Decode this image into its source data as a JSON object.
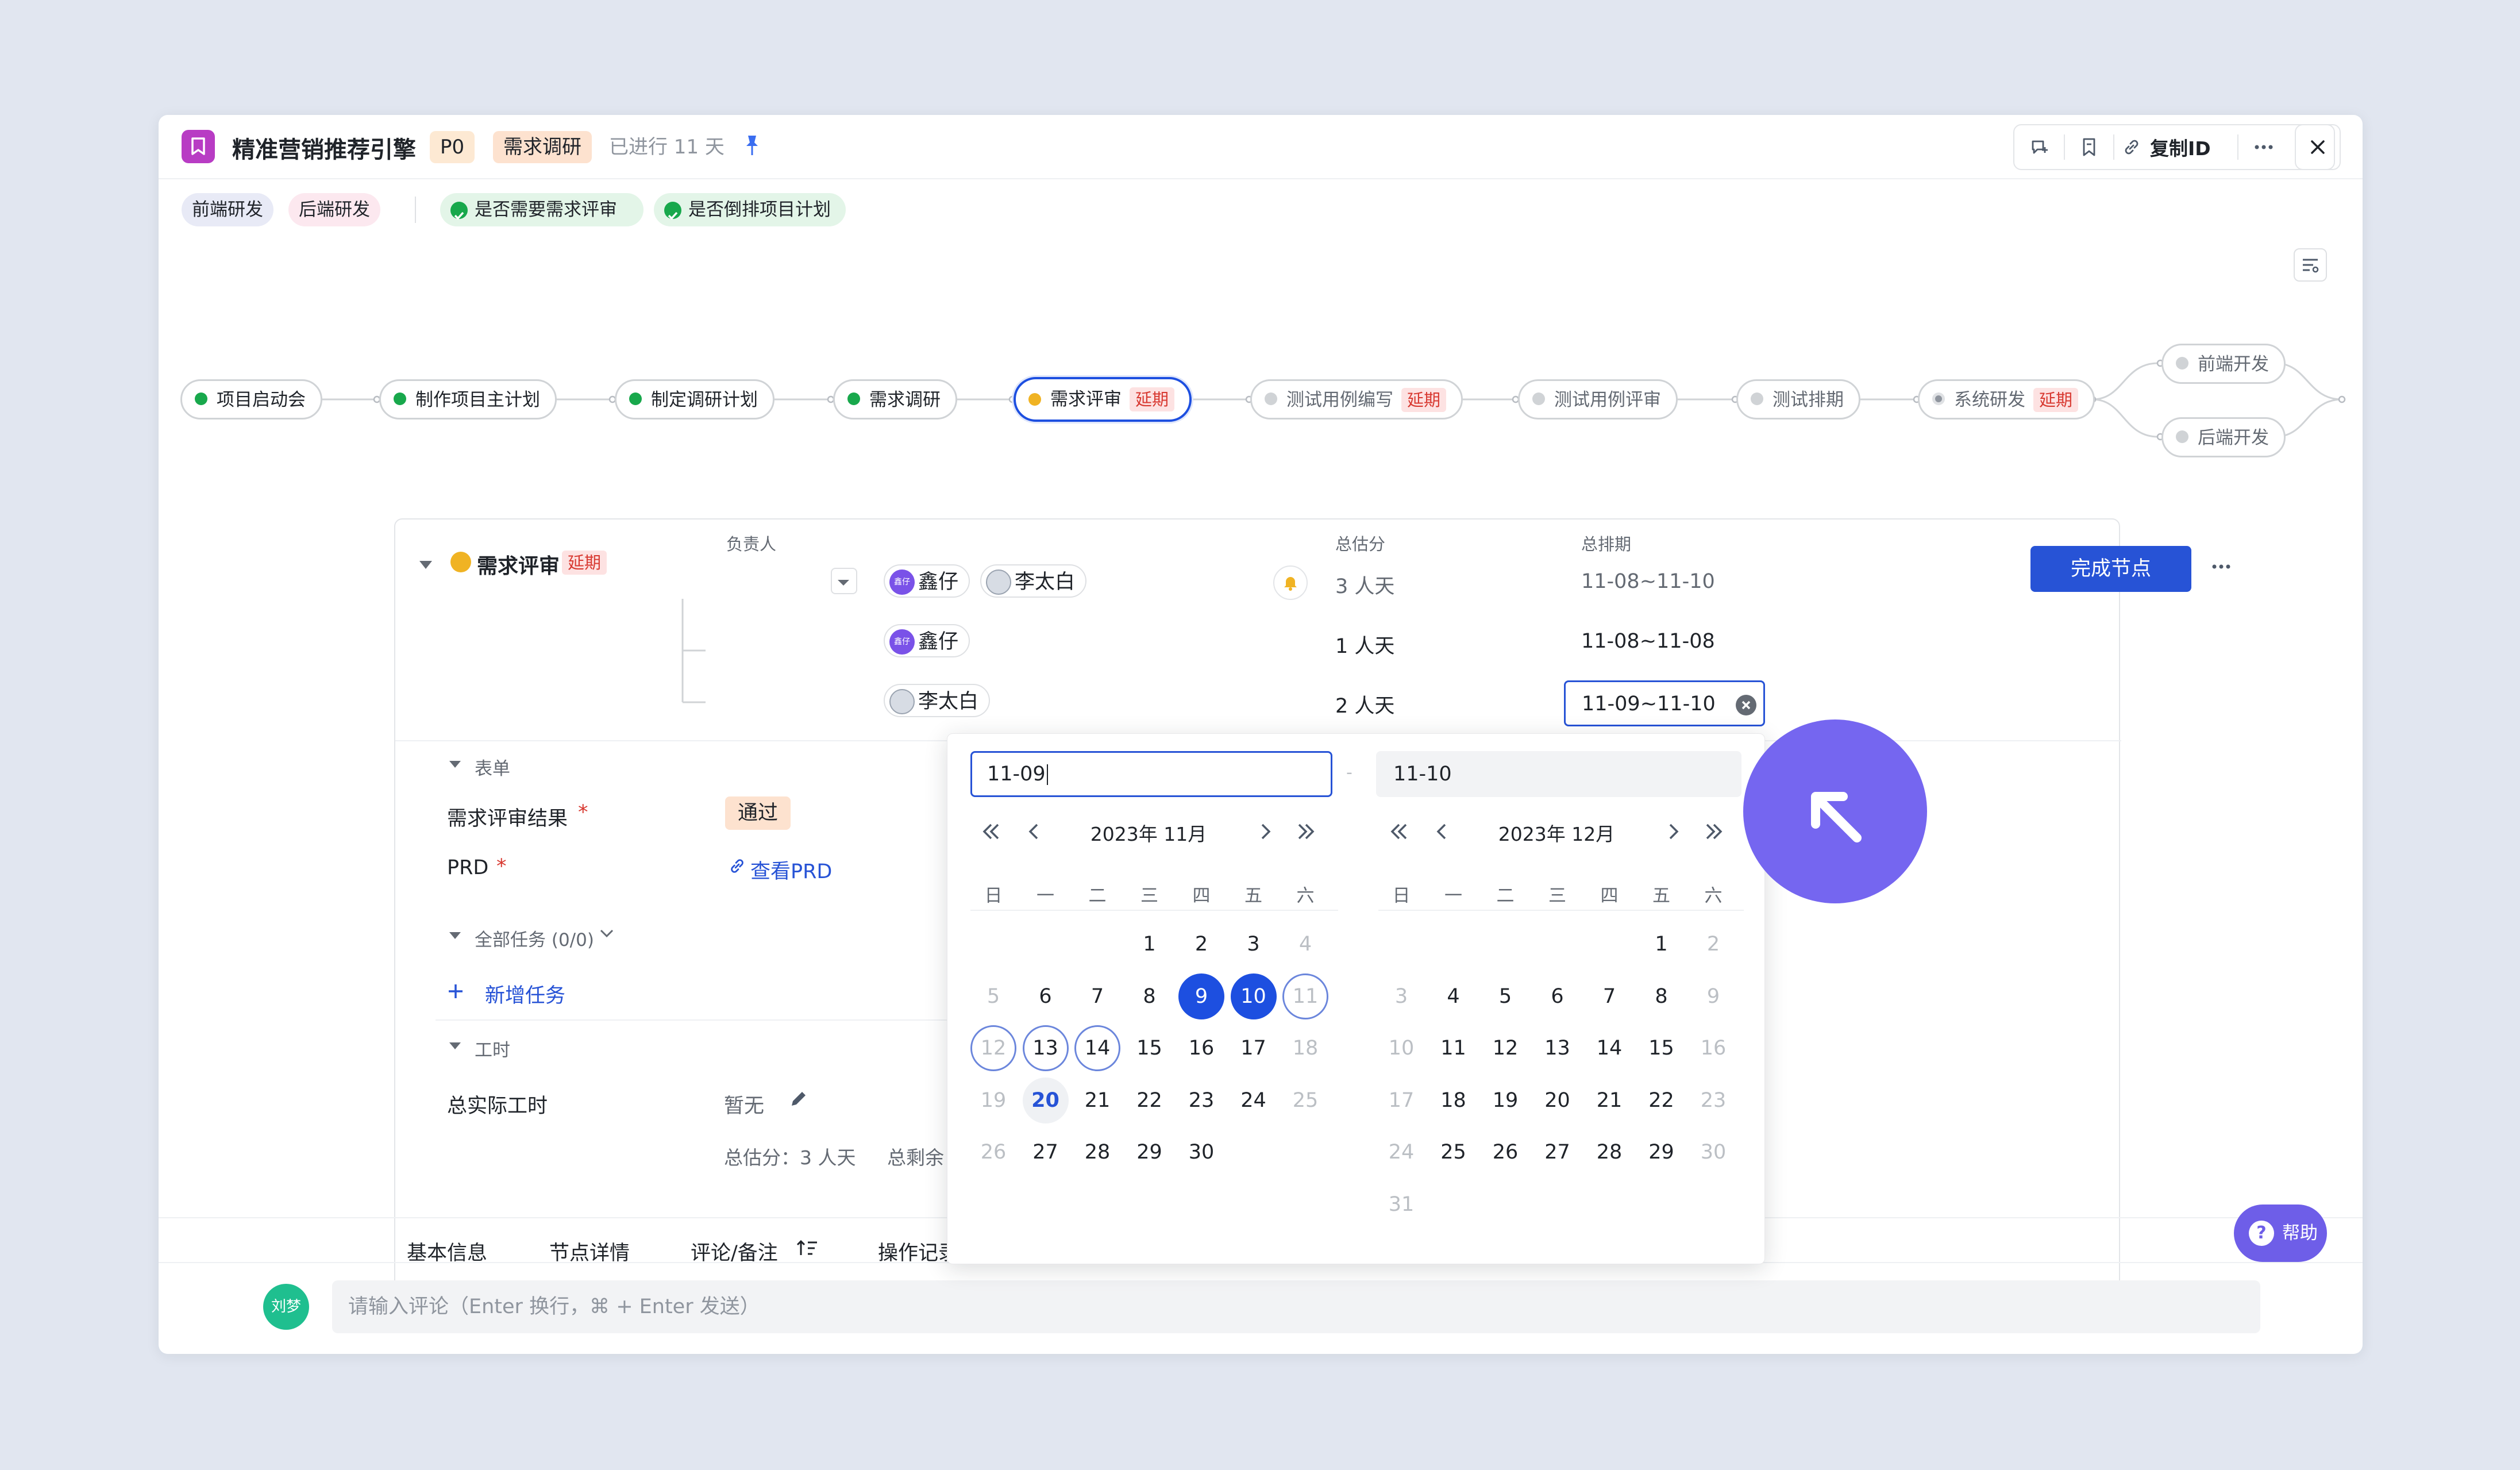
{
  "title": "精准营销推荐引擎",
  "priority": "P0",
  "stage": "需求调研",
  "elapsed": "已进行 11 天",
  "toolbar": {
    "copy_id": "复制ID"
  },
  "tags": [
    "前端研发",
    "后端研发"
  ],
  "checks": [
    "是否需要需求评审",
    "是否倒排项目计划"
  ],
  "flow": {
    "delay": "延期",
    "nodes": [
      "项目启动会",
      "制作项目主计划",
      "制定调研计划",
      "需求调研",
      "需求评审",
      "测试用例编写",
      "测试用例评审",
      "测试排期",
      "系统研发",
      "前端开发",
      "后端开发"
    ]
  },
  "node": {
    "name": "需求评审",
    "delay": "延期",
    "col_owner": "负责人",
    "col_estimate": "总估分",
    "col_schedule": "总排期",
    "complete_btn": "完成节点",
    "rows": [
      {
        "owners": [
          "鑫仔",
          "李太白"
        ],
        "estimate": "3 人天",
        "schedule": "11-08~11-10"
      },
      {
        "owners": [
          "鑫仔"
        ],
        "estimate": "1 人天",
        "schedule": "11-08~11-08"
      },
      {
        "owners": [
          "李太白"
        ],
        "estimate": "2 人天",
        "schedule": "11-09~11-10"
      }
    ],
    "avatar_small": "鑫仔"
  },
  "form": {
    "section": "表单",
    "review_label": "需求评审结果",
    "review_value": "通过",
    "prd_label": "PRD",
    "prd_link": "查看PRD",
    "tasks_section": "全部任务 (0/0)",
    "add_task": "新增任务",
    "hours_section": "工时",
    "actual_hours_label": "总实际工时",
    "actual_hours_value": "暂无",
    "summary_estimate": "总估分：3 人天",
    "summary_remaining": "总剩余"
  },
  "calendar": {
    "start_input": "11-09",
    "end_input": "11-10",
    "separator": "-",
    "left_title": "2023年 11月",
    "right_title": "2023年 12月",
    "weekdays": [
      "日",
      "一",
      "二",
      "三",
      "四",
      "五",
      "六"
    ],
    "left_days": [
      [
        "",
        "",
        "",
        "1",
        "2",
        "3",
        "4"
      ],
      [
        "5",
        "6",
        "7",
        "8",
        "9",
        "10",
        "11"
      ],
      [
        "12",
        "13",
        "14",
        "15",
        "16",
        "17",
        "18"
      ],
      [
        "19",
        "20",
        "21",
        "22",
        "23",
        "24",
        "25"
      ],
      [
        "26",
        "27",
        "28",
        "29",
        "30",
        "",
        ""
      ]
    ],
    "right_days": [
      [
        "",
        "",
        "",
        "",
        "",
        "1",
        "2"
      ],
      [
        "3",
        "4",
        "5",
        "6",
        "7",
        "8",
        "9"
      ],
      [
        "10",
        "11",
        "12",
        "13",
        "14",
        "15",
        "16"
      ],
      [
        "17",
        "18",
        "19",
        "20",
        "21",
        "22",
        "23"
      ],
      [
        "24",
        "25",
        "26",
        "27",
        "28",
        "29",
        "30"
      ],
      [
        "31",
        "",
        "",
        "",
        "",
        "",
        ""
      ]
    ]
  },
  "tabs": [
    "基本信息",
    "节点详情",
    "评论/备注",
    "操作记录"
  ],
  "comment": {
    "avatar": "刘梦",
    "placeholder": "请输入评论（Enter 换行，⌘ + Enter 发送）"
  },
  "help": "帮助",
  "colors": {
    "accent": "#1d4fe0",
    "cursor": "#7566f0",
    "green": "#18a84c",
    "delay_red": "#d83931"
  }
}
